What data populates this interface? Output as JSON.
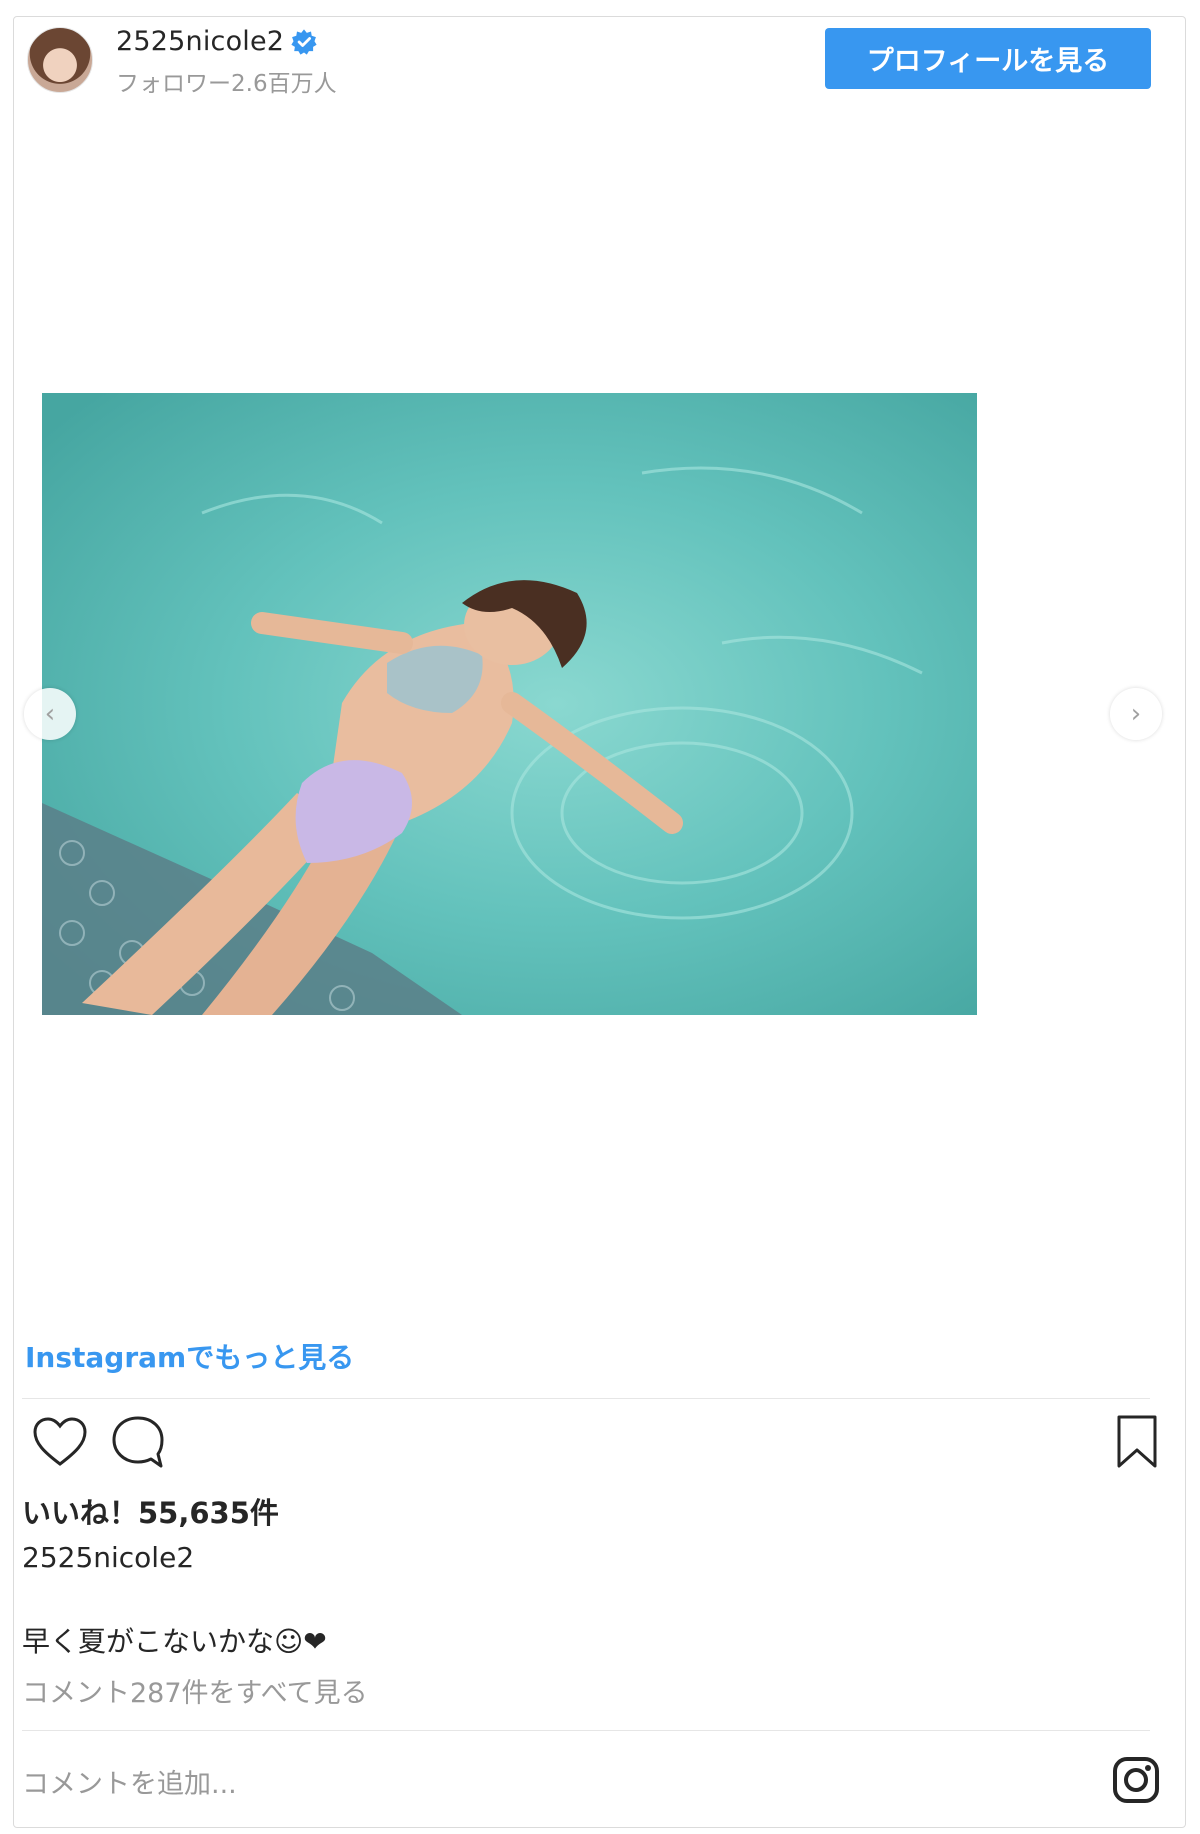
{
  "header": {
    "username": "2525nicole2",
    "followers": "フォロワー2.6百万人",
    "profile_button": "プロフィールを見る",
    "verified_icon": "verified-badge-icon",
    "colors": {
      "accent": "#3897f0",
      "muted": "#999999"
    }
  },
  "post": {
    "image_icon": "photo",
    "carousel": {
      "prev_icon": "chevron-left-icon",
      "next_icon": "chevron-right-icon"
    }
  },
  "more_link": "Instagramでもっと見る",
  "actions": {
    "like_icon": "heart-icon",
    "comment_icon": "comment-bubble-icon",
    "save_icon": "bookmark-icon"
  },
  "likes": "いいね！55,635件",
  "caption": {
    "username": "2525nicole2",
    "text": "早く夏がこないかな☺︎❤︎"
  },
  "view_comments": "コメント287件をすべて見る",
  "add_comment_placeholder": "コメントを追加...",
  "footer_icon": "instagram-logo-icon"
}
